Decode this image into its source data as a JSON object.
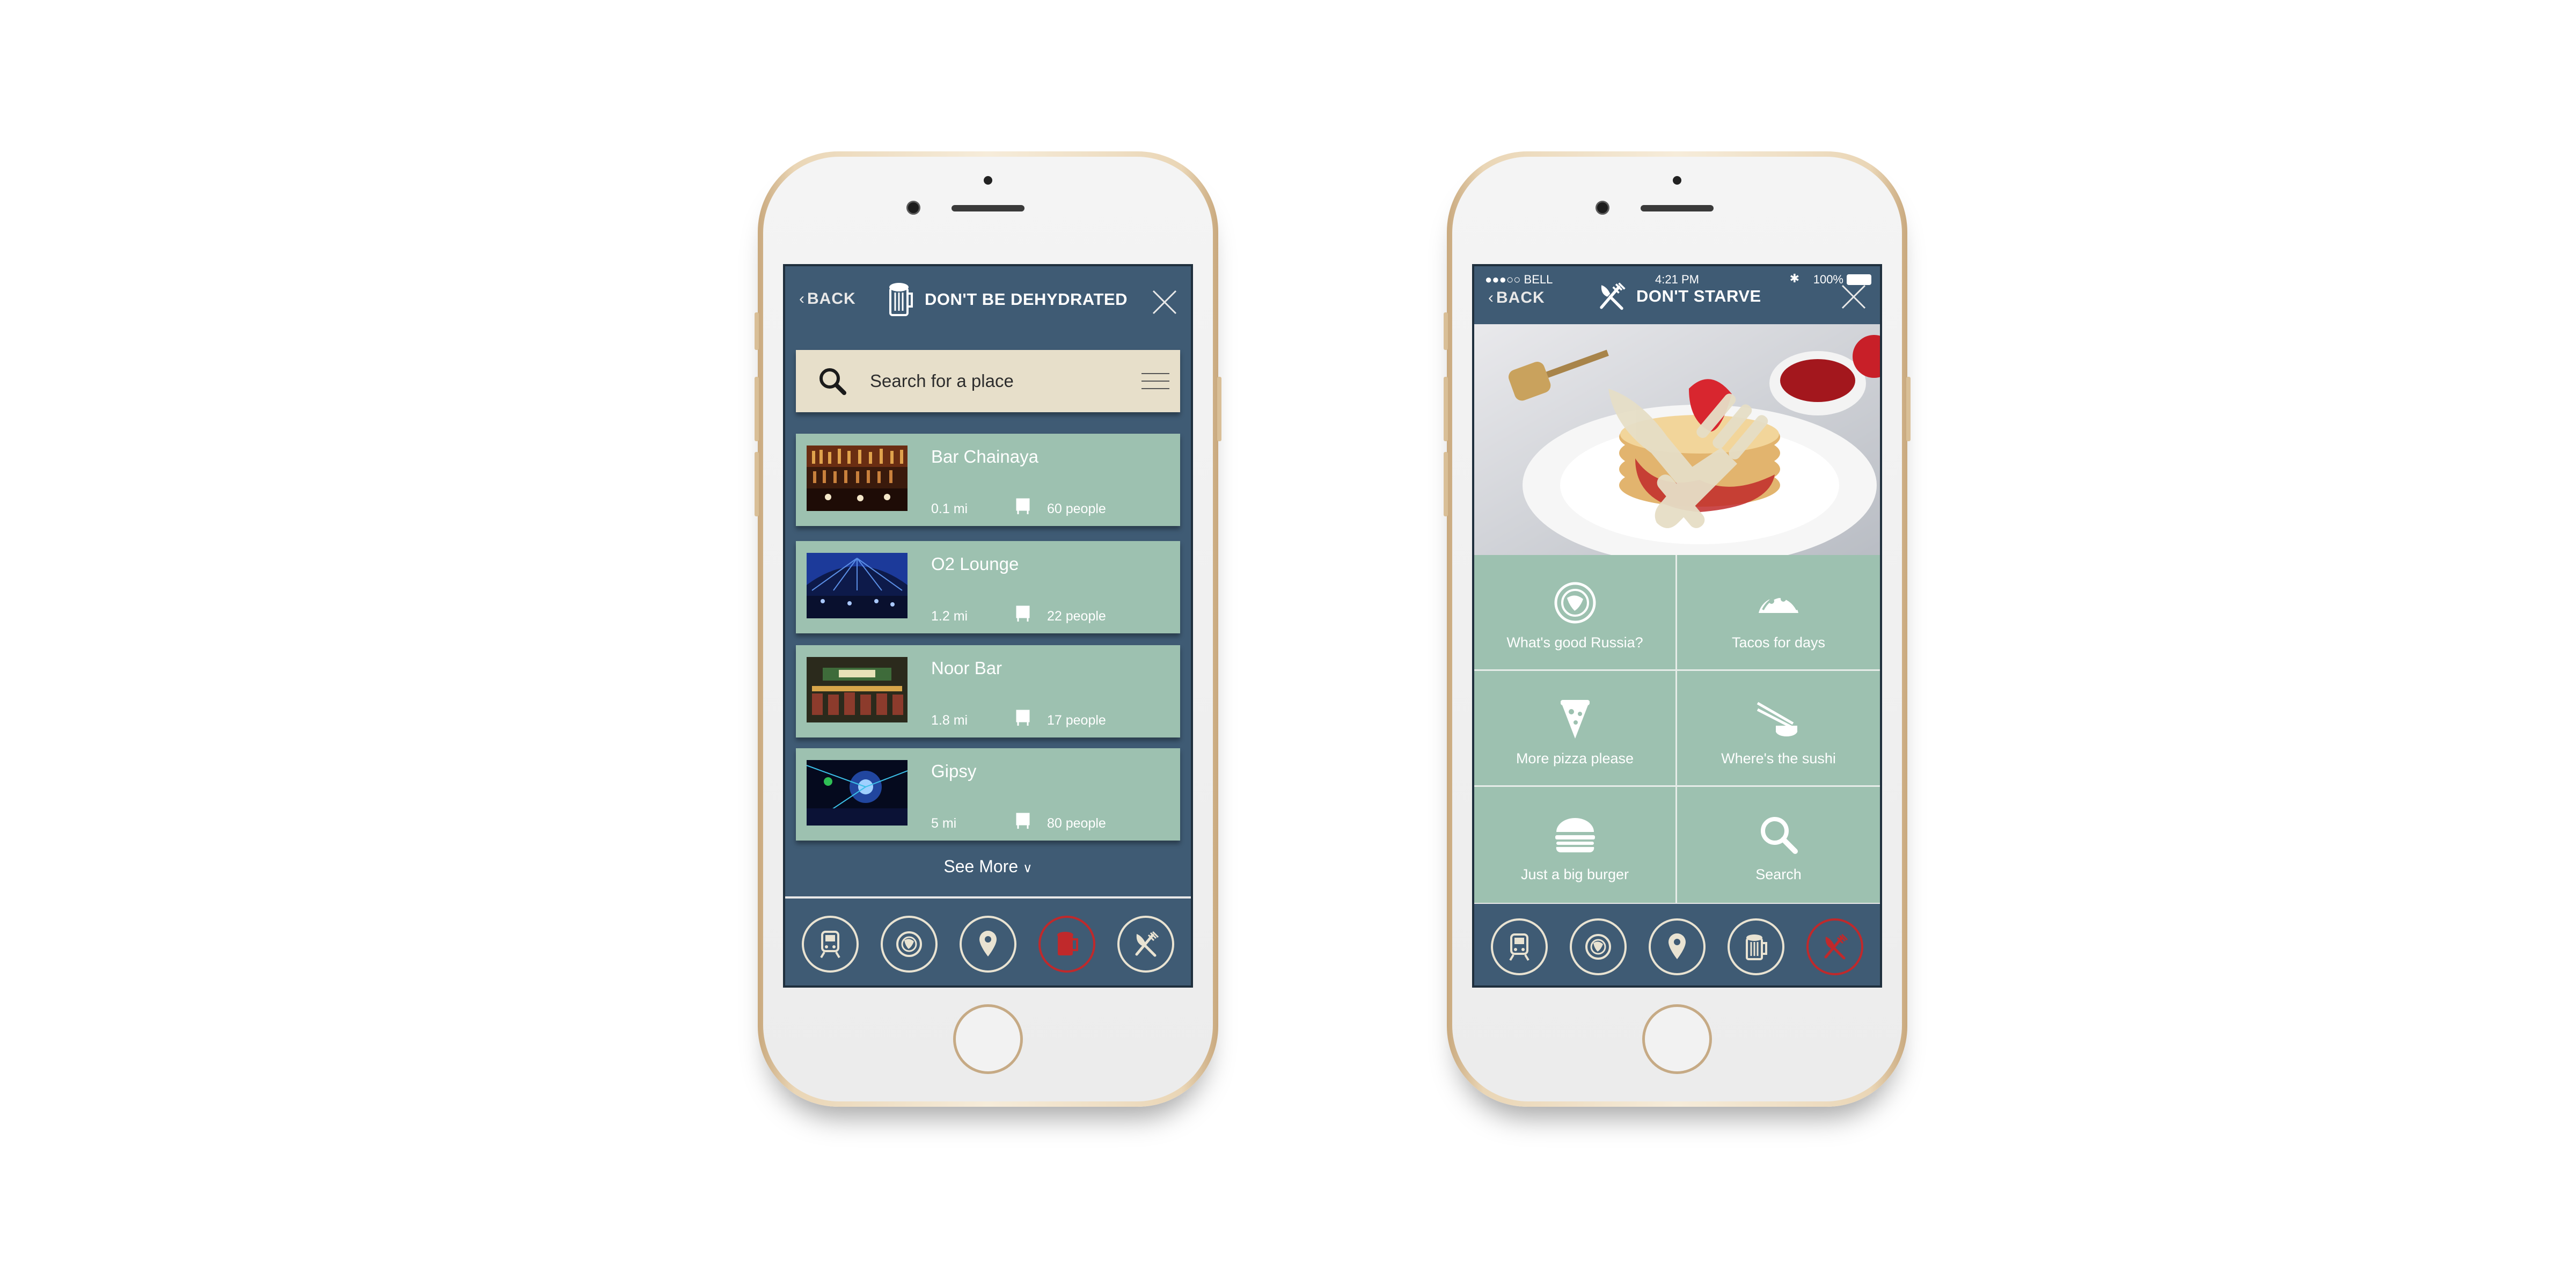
{
  "phone1": {
    "screen": {
      "back_label": "BACK",
      "title": "DON'T BE DEHYDRATED",
      "search": {
        "placeholder": "Search for a place"
      },
      "places": [
        {
          "name": "Bar Chainaya",
          "distance": "0.1 mi",
          "capacity": "60 people"
        },
        {
          "name": "O2 Lounge",
          "distance": "1.2 mi",
          "capacity": "22 people"
        },
        {
          "name": "Noor Bar",
          "distance": "1.8 mi",
          "capacity": "17 people"
        },
        {
          "name": "Gipsy",
          "distance": "5 mi",
          "capacity": "80 people"
        }
      ],
      "see_more": "See More",
      "nav": [
        {
          "icon": "train-icon",
          "active": false
        },
        {
          "icon": "globe-icon",
          "active": false
        },
        {
          "icon": "location-pin-icon",
          "active": false
        },
        {
          "icon": "beer-mug-icon",
          "active": true
        },
        {
          "icon": "fork-knife-icon",
          "active": false
        }
      ]
    }
  },
  "phone2": {
    "status": {
      "carrier": "●●●○○ BELL",
      "time": "4:21 PM",
      "battery": "100%"
    },
    "screen": {
      "back_label": "BACK",
      "title": "DON'T STARVE",
      "categories": [
        {
          "label": "What's good Russia?",
          "icon": "globe-icon"
        },
        {
          "label": "Tacos for days",
          "icon": "taco-icon"
        },
        {
          "label": "More pizza please",
          "icon": "pizza-slice-icon"
        },
        {
          "label": "Where's the sushi",
          "icon": "sushi-chopsticks-icon"
        },
        {
          "label": "Just a big burger",
          "icon": "burger-icon"
        },
        {
          "label": "Search",
          "icon": "search-icon"
        }
      ],
      "nav": [
        {
          "icon": "train-icon",
          "active": false
        },
        {
          "icon": "globe-icon",
          "active": false
        },
        {
          "icon": "location-pin-icon",
          "active": false
        },
        {
          "icon": "beer-mug-icon",
          "active": false
        },
        {
          "icon": "fork-knife-icon",
          "active": true
        }
      ]
    }
  },
  "colors": {
    "screen_bg": "#3f5b74",
    "card_bg": "#9dc1b0",
    "search_bg": "#e7dfca",
    "active_nav": "#c0292b",
    "phone_gold": "#e3c9a2"
  }
}
